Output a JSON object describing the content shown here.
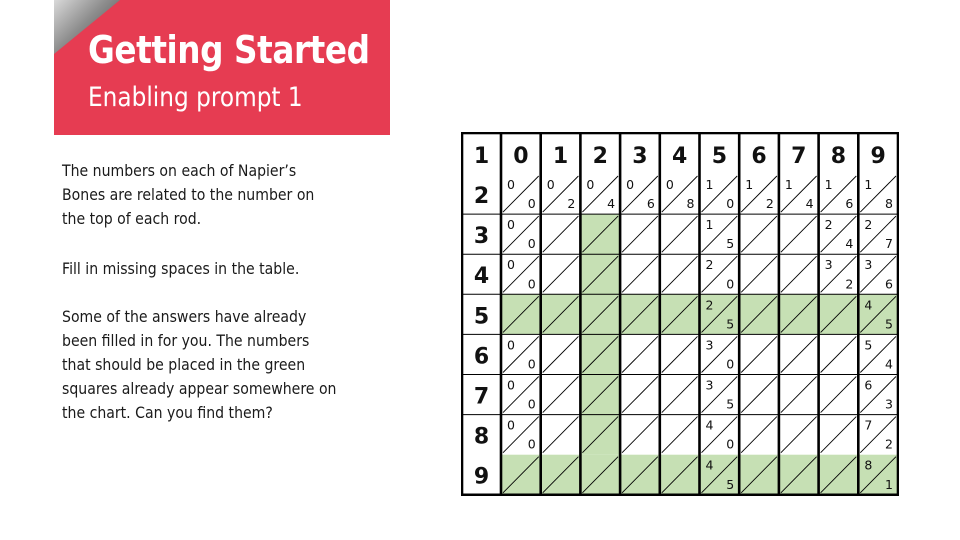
{
  "header": {
    "title": "Getting Started",
    "subtitle": "Enabling prompt 1"
  },
  "instructions": {
    "paragraph1": [
      "The numbers on each of Napier’s",
      "Bones are related to the number on",
      "the top of each rod."
    ],
    "paragraph2": [
      "Fill in missing spaces in the table."
    ],
    "paragraph3": [
      "Some of the answers have already",
      "been filled in for you. The numbers",
      "that should be placed in the green",
      "squares already appear somewhere on",
      "the chart. Can you find them?"
    ]
  },
  "colors": {
    "banner": "#e63c52",
    "green_cell": "#c6e0b4",
    "grid_line": "#000000"
  },
  "napier_table": {
    "corner_label": "1",
    "rods": [
      "0",
      "1",
      "2",
      "3",
      "4",
      "5",
      "6",
      "7",
      "8",
      "9"
    ],
    "multipliers": [
      "2",
      "3",
      "4",
      "5",
      "6",
      "7",
      "8",
      "9"
    ],
    "green_rows": [
      "5",
      "9"
    ],
    "green_rods": [
      "2"
    ],
    "cells": [
      [
        [
          "0",
          "0"
        ],
        [
          "0",
          "2"
        ],
        [
          "0",
          "4"
        ],
        [
          "0",
          "6"
        ],
        [
          "0",
          "8"
        ],
        [
          "1",
          "0"
        ],
        [
          "1",
          "2"
        ],
        [
          "1",
          "4"
        ],
        [
          "1",
          "6"
        ],
        [
          "1",
          "8"
        ]
      ],
      [
        [
          "0",
          "0"
        ],
        null,
        null,
        null,
        null,
        [
          "1",
          "5"
        ],
        null,
        null,
        [
          "2",
          "4"
        ],
        [
          "2",
          "7"
        ]
      ],
      [
        [
          "0",
          "0"
        ],
        null,
        null,
        null,
        null,
        [
          "2",
          "0"
        ],
        null,
        null,
        [
          "3",
          "2"
        ],
        [
          "3",
          "6"
        ]
      ],
      [
        null,
        null,
        null,
        null,
        null,
        [
          "2",
          "5"
        ],
        null,
        null,
        null,
        [
          "4",
          "5"
        ]
      ],
      [
        [
          "0",
          "0"
        ],
        null,
        null,
        null,
        null,
        [
          "3",
          "0"
        ],
        null,
        null,
        null,
        [
          "5",
          "4"
        ]
      ],
      [
        [
          "0",
          "0"
        ],
        null,
        null,
        null,
        null,
        [
          "3",
          "5"
        ],
        null,
        null,
        null,
        [
          "6",
          "3"
        ]
      ],
      [
        [
          "0",
          "0"
        ],
        null,
        null,
        null,
        null,
        [
          "4",
          "0"
        ],
        null,
        null,
        null,
        [
          "7",
          "2"
        ]
      ],
      [
        null,
        null,
        null,
        null,
        null,
        [
          "4",
          "5"
        ],
        null,
        null,
        null,
        [
          "8",
          "1"
        ]
      ]
    ]
  }
}
